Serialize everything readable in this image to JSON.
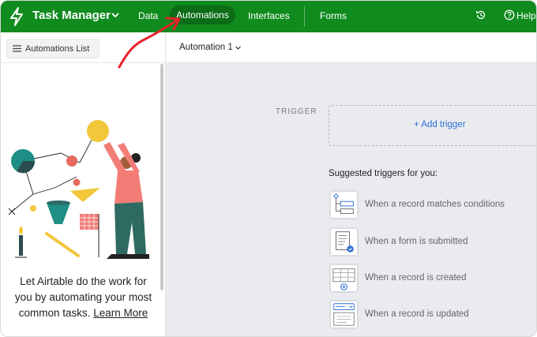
{
  "topbar": {
    "app_title": "Task Manager",
    "nav": {
      "data": "Data",
      "automations": "Automations",
      "interfaces": "Interfaces",
      "forms": "Forms"
    },
    "help": "Help"
  },
  "sidebar": {
    "list_button": "Automations List",
    "promo_text": "Let Airtable do the work for you by automating your most common tasks.",
    "promo_link": "Learn More"
  },
  "main": {
    "automation_name": "Automation 1",
    "trigger_label": "TRIGGER",
    "add_trigger": "+ Add trigger",
    "suggested_title": "Suggested triggers for you:",
    "suggestions": [
      "When a record matches conditions",
      "When a form is submitted",
      "When a record is created",
      "When a record is updated"
    ]
  },
  "colors": {
    "topbar": "#108b1e",
    "accent_link": "#2d6fd6",
    "main_bg": "#e9ebee",
    "annotation_arrow": "#e8232a"
  },
  "icons": [
    "bolt-icon",
    "chevron-down-icon",
    "history-icon",
    "help-icon",
    "menu-icon",
    "trigger-type-icon"
  ]
}
